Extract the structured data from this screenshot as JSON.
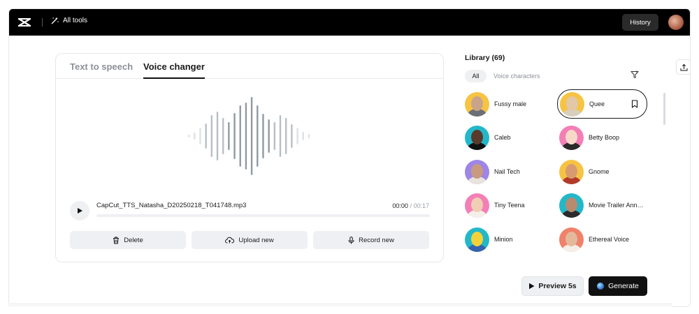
{
  "topbar": {
    "all_tools_label": "All tools",
    "history_label": "History",
    "logo_icon": "capcut-logo-icon",
    "avatar_icon": "user-avatar"
  },
  "editor": {
    "tabs": [
      {
        "label": "Text to speech",
        "active": false
      },
      {
        "label": "Voice changer",
        "active": true
      }
    ],
    "file": {
      "name": "CapCut_TTS_Natasha_D20250218_T041748.mp3",
      "current_time": "00:00",
      "separator": "/",
      "duration": "00:17",
      "progress": 0
    },
    "actions": {
      "delete_label": "Delete",
      "upload_label": "Upload new",
      "record_label": "Record new"
    }
  },
  "library": {
    "title": "Library (69)",
    "filters": {
      "all_label": "All",
      "voice_characters_label": "Voice characters"
    },
    "voices": [
      {
        "name": "Fussy male",
        "bg": "#f6c343"
      },
      {
        "name": "Queen",
        "bg": "#f6c343",
        "selected": true
      },
      {
        "name": "Caleb",
        "bg": "#23b8c9"
      },
      {
        "name": "Betty Boop",
        "bg": "#f37fb6"
      },
      {
        "name": "Nail Tech",
        "bg": "#9d86e6"
      },
      {
        "name": "Gnome",
        "bg": "#f6c343"
      },
      {
        "name": "Tiny Teena",
        "bg": "#f37fb6"
      },
      {
        "name": "Movie Trailer Announcer",
        "bg": "#23b8c9"
      },
      {
        "name": "Minion",
        "bg": "#23b8c9"
      },
      {
        "name": "Ethereal Voice",
        "bg": "#f0816a"
      }
    ]
  },
  "footer": {
    "preview_label": "Preview 5s",
    "generate_label": "Generate"
  }
}
